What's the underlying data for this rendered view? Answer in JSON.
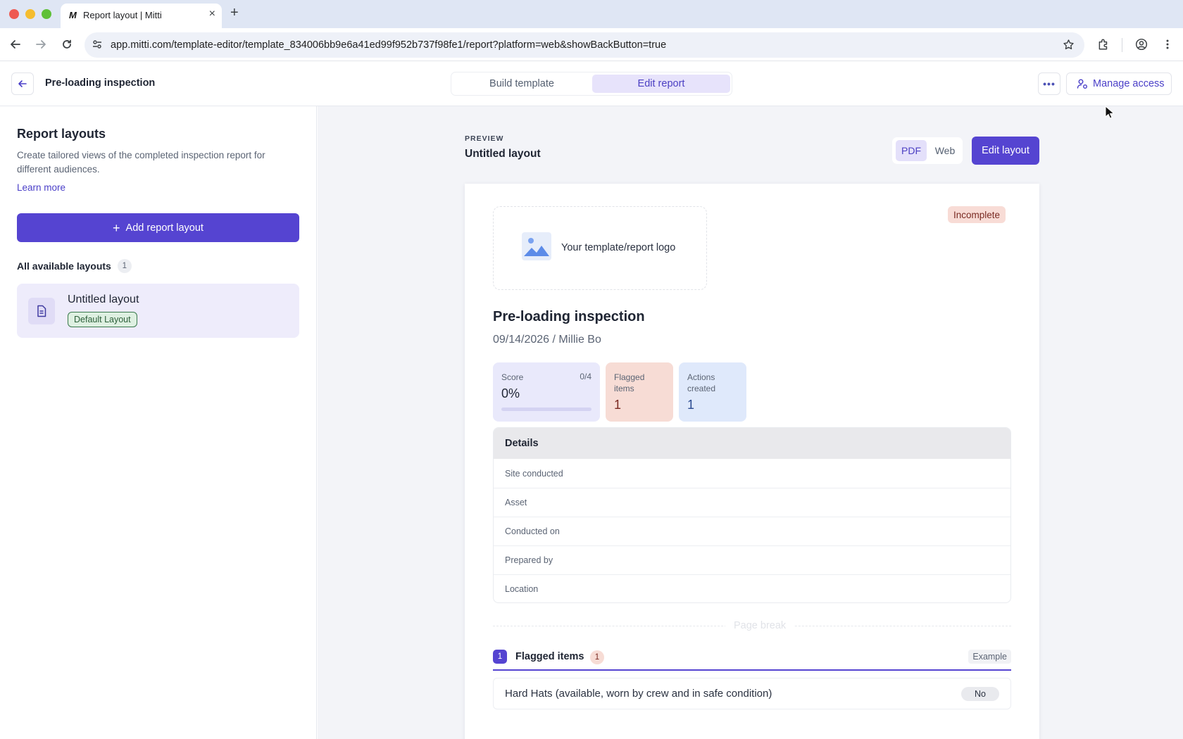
{
  "browser": {
    "tab_title": "Report layout | Mitti",
    "tab_favicon": "M",
    "url": "app.mitti.com/template-editor/template_834006bb9e6a41ed99f952b737f98fe1/report?platform=web&showBackButton=true"
  },
  "header": {
    "title": "Pre-loading inspection",
    "tabs": [
      {
        "label": "Build template"
      },
      {
        "label": "Edit report"
      }
    ],
    "manage_access_label": "Manage access"
  },
  "sidebar": {
    "title": "Report layouts",
    "description": "Create tailored views of the completed inspection report for different audiences.",
    "learn_more": "Learn more",
    "add_button": "Add report layout",
    "all_layouts_label": "All available layouts",
    "all_layouts_count": "1",
    "layouts": [
      {
        "name": "Untitled layout",
        "badge": "Default Layout"
      }
    ]
  },
  "preview": {
    "label": "PREVIEW",
    "title": "Untitled layout",
    "format_pdf": "PDF",
    "format_web": "Web",
    "edit_layout": "Edit layout"
  },
  "report": {
    "logo_text": "Your template/report logo",
    "status": "Incomplete",
    "title": "Pre-loading inspection",
    "meta": "09/14/2026 / Millie Bo",
    "score": {
      "label": "Score",
      "aux": "0/4",
      "value": "0%",
      "progress": 0
    },
    "flagged": {
      "label_line1": "Flagged",
      "label_line2": "items",
      "value": "1"
    },
    "actions": {
      "label_line1": "Actions",
      "label_line2": "created",
      "value": "1"
    },
    "details": {
      "title": "Details",
      "rows": [
        "Site conducted",
        "Asset",
        "Conducted on",
        "Prepared by",
        "Location"
      ]
    },
    "page_break": "Page break",
    "flagged_section": {
      "number": "1",
      "title": "Flagged items",
      "count": "1",
      "example": "Example",
      "items": [
        {
          "question": "Hard Hats (available, worn by crew and in safe condition)",
          "answer": "No"
        }
      ]
    }
  },
  "colors": {
    "accent": "#5544d1",
    "accent_light": "#e7e3fb",
    "flag_bg": "#f7dcd5",
    "action_bg": "#dfe9fb"
  }
}
